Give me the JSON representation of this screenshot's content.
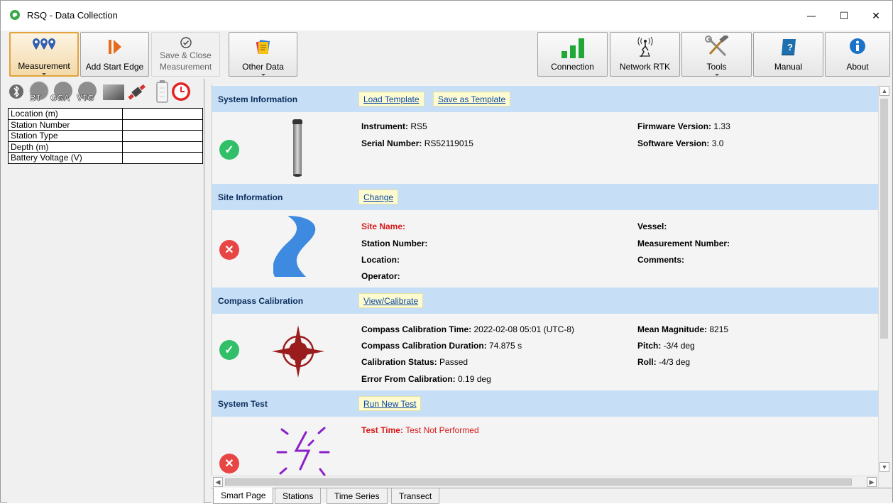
{
  "window": {
    "title": "RSQ - Data Collection",
    "min_glyph": "—",
    "max_glyph": "☐",
    "close_glyph": "✕"
  },
  "ribbon": {
    "measurement": "Measurement",
    "add_start_edge": "Add Start Edge",
    "save_close_line1": "Save & Close",
    "save_close_line2": "Measurement",
    "other_data": "Other Data",
    "connection": "Connection",
    "network_rtk": "Network RTK",
    "tools": "Tools",
    "manual": "Manual",
    "about": "About"
  },
  "status_icons": {
    "bt": "BT",
    "gga": "GGA",
    "vtg": "VTG"
  },
  "left_table": {
    "rows": [
      {
        "label": "Location (m)",
        "value": ""
      },
      {
        "label": "Station Number",
        "value": ""
      },
      {
        "label": "Station Type",
        "value": ""
      },
      {
        "label": "Depth (m)",
        "value": ""
      },
      {
        "label": "Battery Voltage (V)",
        "value": ""
      }
    ]
  },
  "system_info": {
    "title": "System Information",
    "load_template": "Load Template",
    "save_as_template": "Save as Template",
    "status": "ok",
    "instrument_label": "Instrument:",
    "instrument_value": "RS5",
    "serial_label": "Serial Number:",
    "serial_value": "RS52119015",
    "firmware_label": "Firmware Version:",
    "firmware_value": "1.33",
    "software_label": "Software Version:",
    "software_value": "3.0"
  },
  "site_info": {
    "title": "Site Information",
    "change": "Change",
    "status": "error",
    "site_name_label": "Site Name:",
    "station_number_label": "Station Number:",
    "location_label": "Location:",
    "operator_label": "Operator:",
    "vessel_label": "Vessel:",
    "measurement_number_label": "Measurement Number:",
    "comments_label": "Comments:"
  },
  "compass": {
    "title": "Compass Calibration",
    "view_calibrate": "View/Calibrate",
    "status": "ok",
    "cal_time_label": "Compass Calibration Time:",
    "cal_time_value": "2022-02-08 05:01 (UTC-8)",
    "cal_duration_label": "Compass Calibration Duration:",
    "cal_duration_value": "74.875 s",
    "cal_status_label": "Calibration Status:",
    "cal_status_value": "Passed",
    "error_label": "Error From Calibration:",
    "error_value": "0.19 deg",
    "mean_mag_label": "Mean Magnitude:",
    "mean_mag_value": "8215",
    "pitch_label": "Pitch:",
    "pitch_value": "-3/4 deg",
    "roll_label": "Roll:",
    "roll_value": "-4/3 deg"
  },
  "system_test": {
    "title": "System Test",
    "run_new_test": "Run New Test",
    "status": "error",
    "test_time_label": "Test Time:",
    "test_time_value": "Test Not Performed"
  },
  "tabs": [
    "Smart Page",
    "Stations",
    "Time Series",
    "Transect"
  ],
  "colors": {
    "section_header": "#c6dff7",
    "ok": "#32bf6a",
    "error": "#e84545",
    "link": "#0a48a8",
    "link_bg": "#fdfbcf",
    "selected_ribbon": "#e3a33a"
  }
}
